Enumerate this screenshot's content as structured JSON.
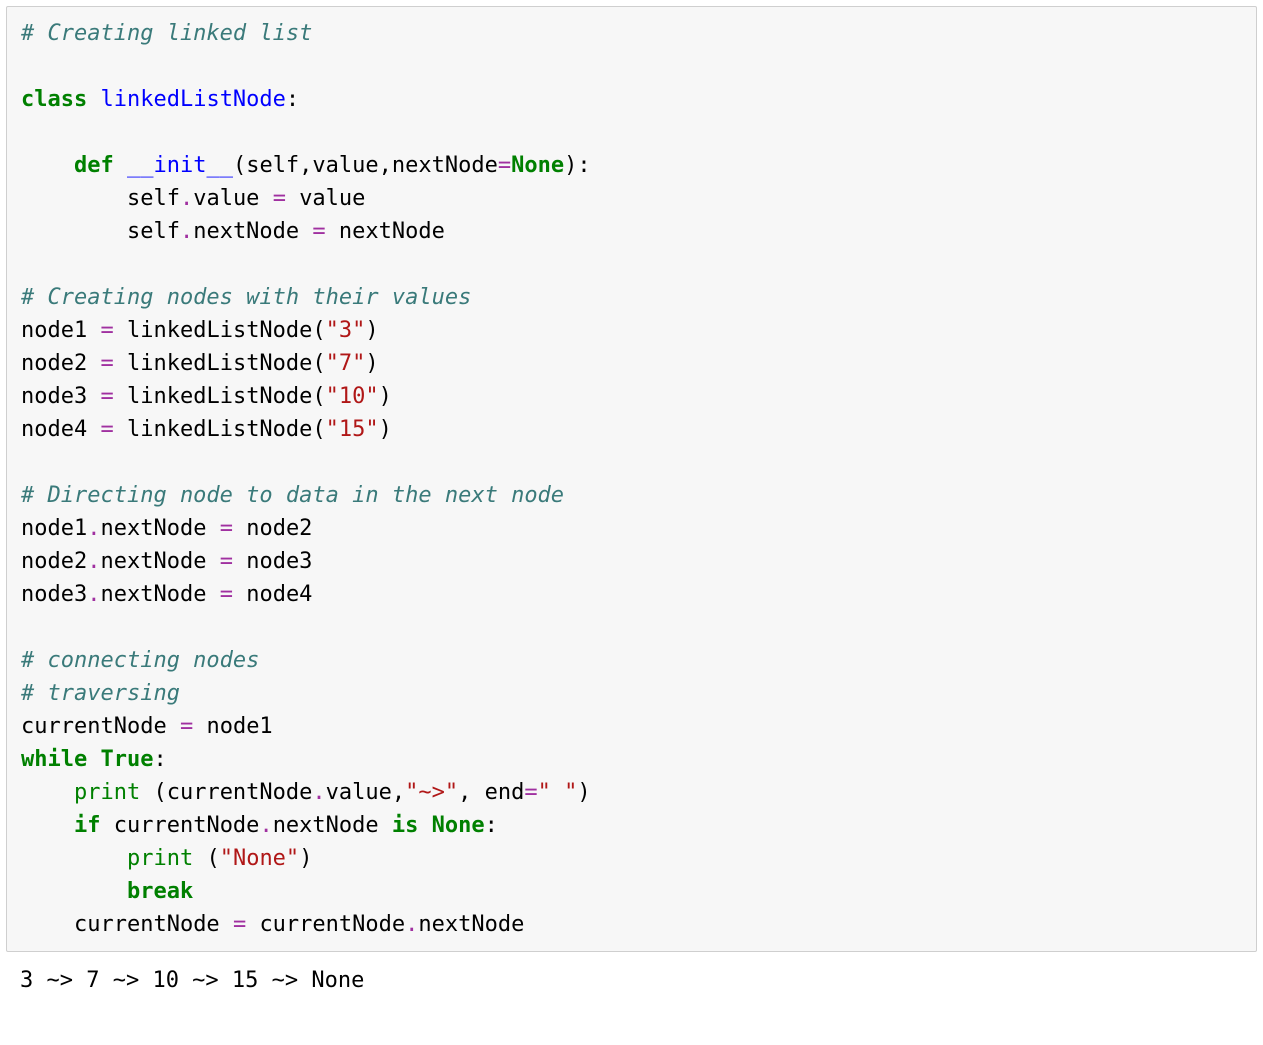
{
  "code": {
    "comment1": "# Creating linked list",
    "kw_class": "class",
    "class_name": "linkedListNode",
    "colon1": ":",
    "kw_def": "def",
    "init_name": "__init__",
    "init_params_open": "(self,value,nextNode",
    "op_eq1": "=",
    "none1": "None",
    "init_params_close": "):",
    "line_selfvalue_a": "self",
    "line_selfvalue_b": ".value ",
    "op_assign1": "= ",
    "line_selfvalue_c": "value",
    "line_selfnext_a": "self",
    "line_selfnext_b": ".nextNode ",
    "op_assign2": "= ",
    "line_selfnext_c": "nextNode",
    "comment2": "# Creating nodes with their values",
    "n1a": "node1 ",
    "n1b": "= ",
    "n1c": "linkedListNode(",
    "n1s": "\"3\"",
    "n1d": ")",
    "n2a": "node2 ",
    "n2b": "= ",
    "n2c": "linkedListNode(",
    "n2s": "\"7\"",
    "n2d": ")",
    "n3a": "node3 ",
    "n3b": "= ",
    "n3c": "linkedListNode(",
    "n3s": "\"10\"",
    "n3d": ")",
    "n4a": "node4 ",
    "n4b": "= ",
    "n4c": "linkedListNode(",
    "n4s": "\"15\"",
    "n4d": ")",
    "comment3": "# Directing node to data in the next node",
    "d1a": "node1",
    "d1b": ".nextNode ",
    "d1op": "= ",
    "d1c": "node2",
    "d2a": "node2",
    "d2b": ".nextNode ",
    "d2op": "= ",
    "d2c": "node3",
    "d3a": "node3",
    "d3b": ".nextNode ",
    "d3op": "= ",
    "d3c": "node4",
    "comment4": "# connecting nodes",
    "comment5": "# traversing",
    "cn_a": "currentNode ",
    "cn_op": "= ",
    "cn_b": "node1",
    "kw_while": "while",
    "sp1": " ",
    "true1": "True",
    "colon2": ":",
    "indent1": "    ",
    "indent2": "        ",
    "print1": "print",
    "p1_open": " (currentNode",
    "p1_mid": ".value,",
    "p1_str": "\"~>\"",
    "p1_comma": ", end",
    "p1_eq": "=",
    "p1_str2": "\" \"",
    "p1_close": ")",
    "kw_if": "if",
    "if_body": " currentNode",
    "if_body2": ".nextNode ",
    "kw_is": "is",
    "sp2": " ",
    "none2": "None",
    "colon3": ":",
    "print2": "print",
    "p2_open": " (",
    "p2_str": "\"None\"",
    "p2_close": ")",
    "kw_break": "break",
    "last_a": "currentNode ",
    "last_op": "= ",
    "last_b": "currentNode",
    "last_c": ".nextNode"
  },
  "output": "3 ~> 7 ~> 10 ~> 15 ~> None"
}
